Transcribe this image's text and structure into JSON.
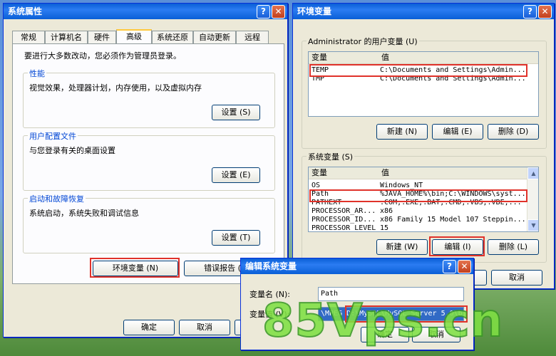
{
  "sysprops": {
    "title": "系统属性",
    "tabs": [
      "常规",
      "计算机名",
      "硬件",
      "高级",
      "系统还原",
      "自动更新",
      "远程"
    ],
    "active_tab_index": 3,
    "admin_note": "要进行大多数改动，您必须作为管理员登录。",
    "performance": {
      "label": "性能",
      "text": "视觉效果，处理器计划，内存使用，以及虚拟内存",
      "button": "设置 (S)"
    },
    "user_profiles": {
      "label": "用户配置文件",
      "text": "与您登录有关的桌面设置",
      "button": "设置 (E)"
    },
    "startup": {
      "label": "启动和故障恢复",
      "text": "系统启动，系统失败和调试信息",
      "button": "设置 (T)"
    },
    "env_button": "环境变量 (N)",
    "error_report_button": "错误报告 (R)",
    "ok": "确定",
    "cancel": "取消"
  },
  "envvars": {
    "title": "环境变量",
    "user_label": "Administrator 的用户变量 (U)",
    "user_headers": {
      "name": "变量",
      "value": "值"
    },
    "user_rows": [
      {
        "name": "TEMP",
        "value": "C:\\Documents and Settings\\Admin..."
      },
      {
        "name": "TMP",
        "value": "C:\\Documents and Settings\\Admin..."
      }
    ],
    "user_buttons": {
      "new": "新建 (N)",
      "edit": "编辑 (E)",
      "delete": "删除 (D)"
    },
    "sys_label": "系统变量 (S)",
    "sys_headers": {
      "name": "变量",
      "value": "值"
    },
    "sys_rows": [
      {
        "name": "OS",
        "value": "Windows_NT"
      },
      {
        "name": "Path",
        "value": "%JAVA_HOME%\\bin;C:\\WINDOWS\\syst..."
      },
      {
        "name": "PATHEXT",
        "value": ".COM;.EXE;.BAT;.CMD;.VBS;.VBE;..."
      },
      {
        "name": "PROCESSOR_AR...",
        "value": "x86"
      },
      {
        "name": "PROCESSOR_ID...",
        "value": "x86 Family 15 Model 107 Steppin..."
      },
      {
        "name": "PROCESSOR_LEVEL",
        "value": "15"
      }
    ],
    "sys_buttons": {
      "new": "新建 (W)",
      "edit": "编辑 (I)",
      "delete": "删除 (L)"
    },
    "cancel": "取消"
  },
  "editvar": {
    "title": "编辑系统变量",
    "name_label": "变量名 (N):",
    "name_value": "Path",
    "value_label": "变量值 (V):",
    "value_value": "\\MPEG D:\\MySQL\\MySQL Server 5.0\\bin",
    "ok": "确定",
    "cancel": "取消"
  },
  "watermark": "85Vps.cn"
}
